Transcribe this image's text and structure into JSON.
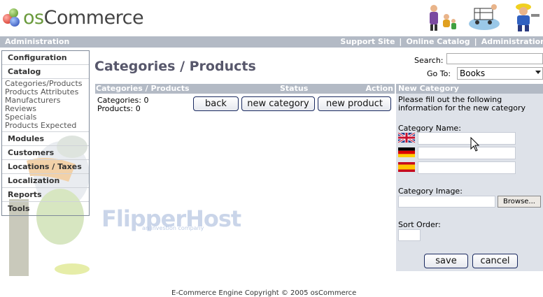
{
  "header": {
    "logo_prefix": "os",
    "logo_suffix": "Commerce"
  },
  "admin_bar": {
    "left": "Administration",
    "links": [
      "Support Site",
      "Online Catalog",
      "Administration"
    ],
    "separator": "|"
  },
  "menu": {
    "configuration": "Configuration",
    "catalog": "Catalog",
    "catalog_items": [
      "Categories/Products",
      "Products Attributes",
      "Manufacturers",
      "Reviews",
      "Specials",
      "Products Expected"
    ],
    "modules": "Modules",
    "customers": "Customers",
    "locations_taxes": "Locations / Taxes",
    "localization": "Localization",
    "reports": "Reports",
    "tools": "Tools"
  },
  "page": {
    "title": "Categories / Products",
    "search_label": "Search:",
    "search_value": "",
    "goto_label": "Go To:",
    "goto_value": "Books"
  },
  "table": {
    "col_categories": "Categories / Products",
    "col_status": "Status",
    "col_action": "Action",
    "categories_count": "Categories: 0",
    "products_count": "Products: 0",
    "back_label": "back",
    "new_category_label": "new category",
    "new_product_label": "new product"
  },
  "panel": {
    "heading": "New Category",
    "intro": "Please fill out the following information for the new category",
    "category_name_label": "Category Name:",
    "category_image_label": "Category Image:",
    "browse_label": "Browse...",
    "sort_order_label": "Sort Order:",
    "save_label": "save",
    "cancel_label": "cancel"
  },
  "watermark": {
    "brand": "FlipperHost",
    "tagline": "an investion company"
  },
  "footer": {
    "text": "E-Commerce Engine Copyright © 2005 osCommerce"
  },
  "colors": {
    "bar": "#b3bac5",
    "panel_bg": "#dee2e9",
    "title": "#57576b",
    "button_border": "#1a2a60"
  },
  "icons": [
    "uk-flag-icon",
    "germany-flag-icon",
    "spain-flag-icon",
    "mouse-cursor-icon",
    "dropdown-arrow-icon"
  ]
}
